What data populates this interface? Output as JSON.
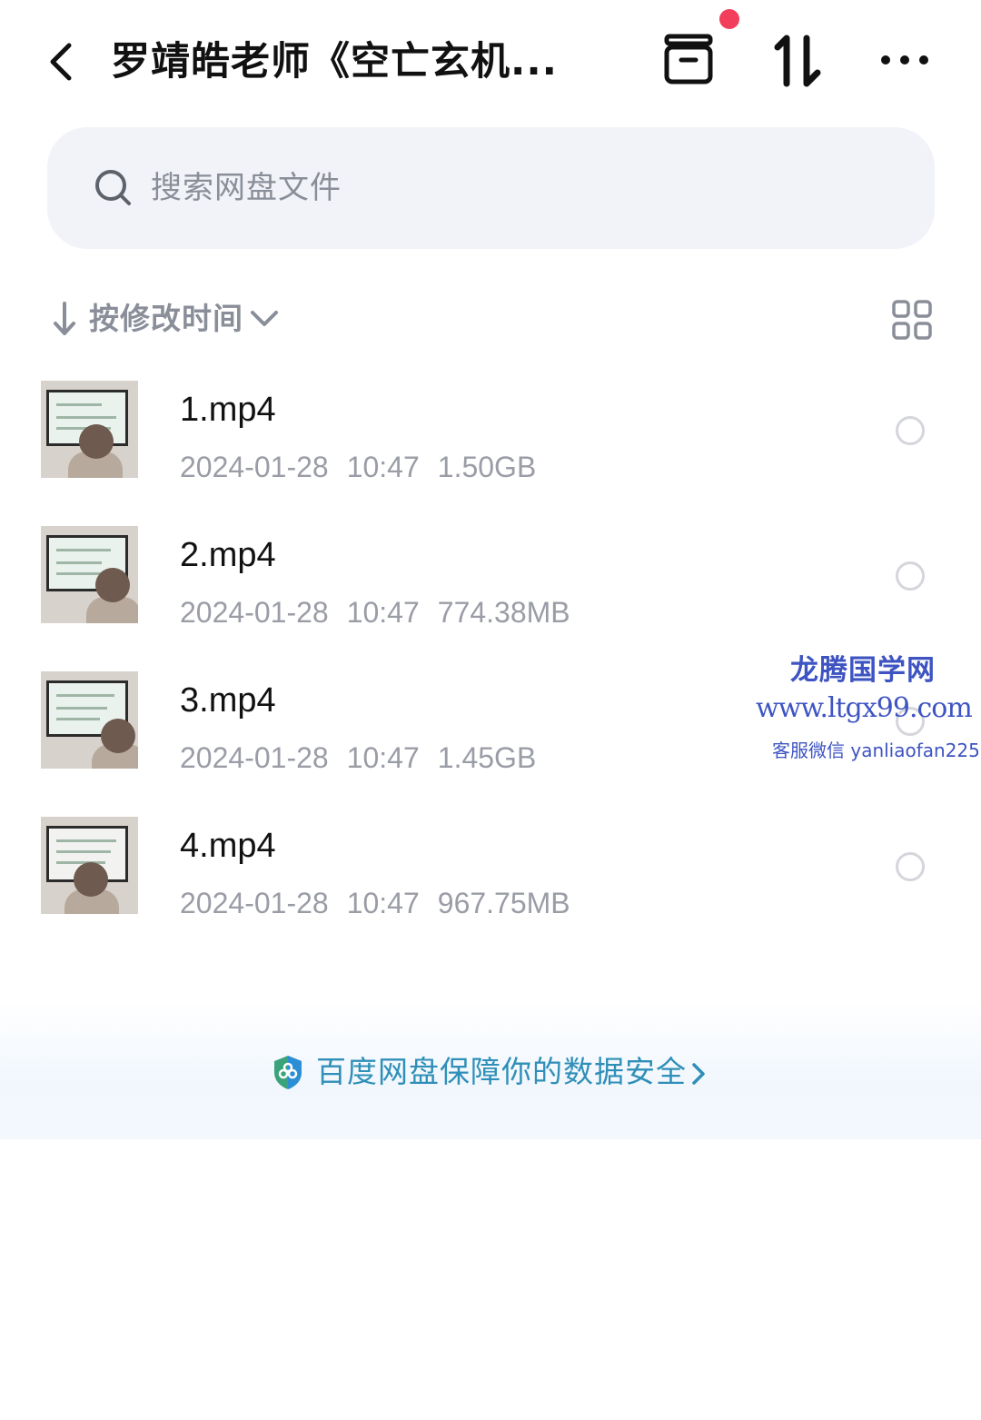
{
  "header": {
    "title": "罗靖皓老师《空亡玄机...",
    "icons": [
      "back-icon",
      "archive-icon",
      "sort-icon",
      "more-icon"
    ],
    "notification_dot_color": "#f23d5b"
  },
  "search": {
    "placeholder": "搜索网盘文件"
  },
  "sort": {
    "label": "按修改时间"
  },
  "files": [
    {
      "name": "1.mp4",
      "date": "2024-01-28",
      "time": "10:47",
      "size": "1.50GB"
    },
    {
      "name": "2.mp4",
      "date": "2024-01-28",
      "time": "10:47",
      "size": "774.38MB"
    },
    {
      "name": "3.mp4",
      "date": "2024-01-28",
      "time": "10:47",
      "size": "1.45GB"
    },
    {
      "name": "4.mp4",
      "date": "2024-01-28",
      "time": "10:47",
      "size": "967.75MB"
    }
  ],
  "watermark": {
    "site": "龙腾国学网",
    "url": "www.ltgx99.com",
    "wechat": "客服微信 yanliaofan225"
  },
  "banner": {
    "text": "百度网盘保障你的数据安全",
    "color": "#2f8fb8"
  }
}
